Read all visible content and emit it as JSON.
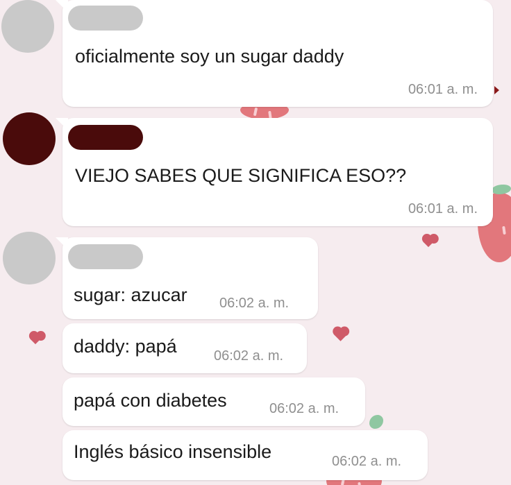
{
  "messages": [
    {
      "sender_avatar": "gray-avatar",
      "text": "oficialmente soy un sugar daddy",
      "time": "06:01 a. m."
    },
    {
      "sender_avatar": "dark-red-avatar",
      "text": "VIEJO SABES QUE SIGNIFICA ESO??",
      "time": "06:01 a. m."
    },
    {
      "sender_avatar": "gray-avatar",
      "text": "sugar: azucar",
      "time": "06:02 a. m."
    },
    {
      "sender_avatar": "gray-avatar",
      "text": "daddy: papá",
      "time": "06:02 a. m."
    },
    {
      "sender_avatar": "gray-avatar",
      "text": "papá con diabetes",
      "time": "06:02 a. m."
    },
    {
      "sender_avatar": "gray-avatar",
      "text": "Inglés básico insensible",
      "time": "06:02 a. m."
    }
  ],
  "colors": {
    "background": "#f6ecef",
    "bubble": "#ffffff",
    "redacted_gray": "#c9c9c9",
    "redacted_dark": "#4a0b0b",
    "timestamp": "#8f8f8f",
    "wallpaper_strawberry": "#e2777c",
    "wallpaper_heart": "#cf5a68"
  }
}
